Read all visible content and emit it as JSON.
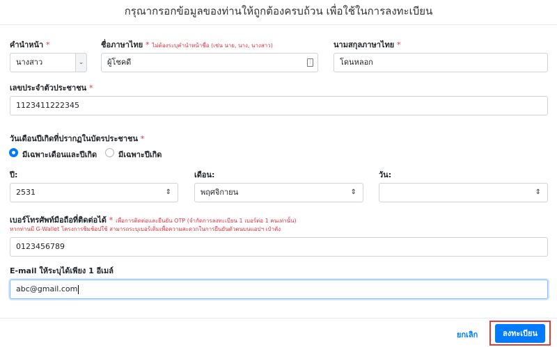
{
  "header": {
    "title": "กรุณากรอกข้อมูลของท่านให้ถูกต้องครบถ้วน เพื่อใช้ในการลงทะเบียน"
  },
  "required_mark": "*",
  "prefix": {
    "label": "คำนำหน้า",
    "value": "นางสาว"
  },
  "first_name": {
    "label": "ชื่อภาษาไทย",
    "note": "ไม่ต้องระบุคำนำหน้าชื่อ (เช่น นาย, นาง, นางสาว)",
    "value": "ผู้โชคดี"
  },
  "last_name": {
    "label": "นามสกุลภาษาไทย",
    "value": "โดนหลอก"
  },
  "id_card": {
    "label": "เลขประจำตัวประชาชน",
    "value": "1123411222345"
  },
  "birthdate": {
    "label": "วันเดือนปีเกิดที่ปรากฏในบัตรประชาชน",
    "options": [
      {
        "label": "มีเฉพาะเดือนและปีเกิด",
        "checked": true
      },
      {
        "label": "มีเฉพาะปีเกิด",
        "checked": false
      }
    ],
    "year_label": "ปี:",
    "year_value": "2531",
    "month_label": "เดือน:",
    "month_value": "พฤศจิกายน",
    "day_label": "วัน:",
    "day_value": ""
  },
  "phone": {
    "label": "เบอร์โทรศัพท์มือถือที่ติดต่อได้",
    "note": "เพื่อการติดต่อและยืนยัน OTP (จำกัดการลงทะเบียน 1 เบอร์ต่อ 1 คนเท่านั้น)",
    "note2": "หากท่านมี G-Wallet โครงการชิมช้อปใช้ สามารถระบุเบอร์เดิมเพื่อความสะดวกในการยืนยันตัวตนบนแอปฯ เป๋าตัง",
    "value": "0123456789"
  },
  "email": {
    "label": "E-mail ให้ระบุได้เพียง 1 อีเมล์",
    "value": "abc@gmail.com"
  },
  "footer": {
    "cancel_label": "ยกเลิก",
    "submit_label": "ลงทะเบียน"
  },
  "icons": {
    "dropdown": "chevron-down-icon",
    "updown": "updown-arrows-icon",
    "keypad": "keypad-icon"
  }
}
